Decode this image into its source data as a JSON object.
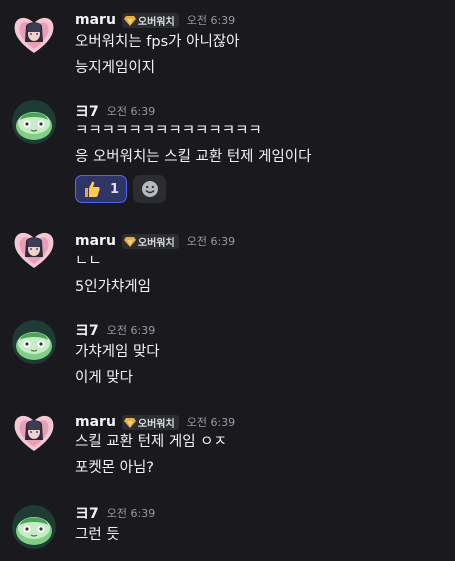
{
  "messages": [
    {
      "author": "maru",
      "tag": "오버워치",
      "time": "오전 6:39",
      "avatar": "maru-heart-avatar",
      "lines": [
        "오버워치는 fps가 아니잖아",
        "능지게임이지"
      ]
    },
    {
      "author": "ヨ7",
      "time": "오전 6:39",
      "avatar": "melon-slime-avatar",
      "lines": [
        "ㅋㅋㅋㅋㅋㅋㅋㅋㅋㅋㅋㅋㅋㅋ",
        "응 오버워치는 스킬 교환 턴제 게임이다"
      ],
      "reactions": [
        {
          "emoji": "thumbs-up-icon",
          "count": "1"
        }
      ]
    },
    {
      "author": "maru",
      "tag": "오버워치",
      "time": "오전 6:39",
      "avatar": "maru-heart-avatar",
      "lines": [
        "ㄴㄴ",
        "5인가챠게임"
      ]
    },
    {
      "author": "ヨ7",
      "time": "오전 6:39",
      "avatar": "melon-slime-avatar",
      "lines": [
        "가챠게임 맞다",
        "이게 맞다"
      ]
    },
    {
      "author": "maru",
      "tag": "오버워치",
      "time": "오전 6:39",
      "avatar": "maru-heart-avatar",
      "lines": [
        "스킬 교환 턴제 게임 ㅇㅈ",
        "포켓몬 아님?"
      ]
    },
    {
      "author": "ヨ7",
      "time": "오전 6:39",
      "avatar": "melon-slime-avatar",
      "lines": [
        "그런 듯"
      ]
    }
  ],
  "colors": {
    "background": "#1a1a1e",
    "reaction_accent": "#5865f2",
    "tag_background": "#2b2d31",
    "gem": "#e8b040"
  }
}
